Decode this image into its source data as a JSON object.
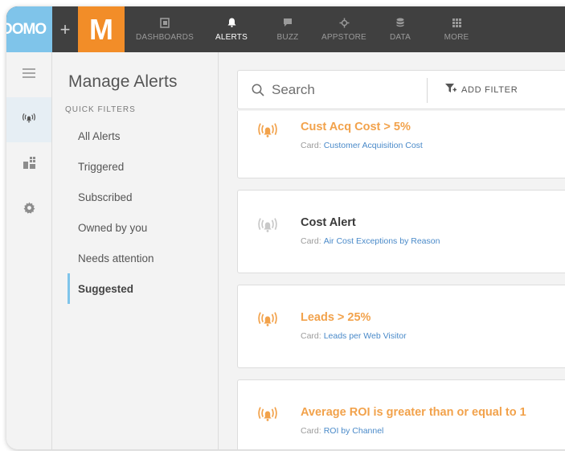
{
  "brand": {
    "logo_text": "DOMO",
    "plus": "+",
    "m_letter": "M"
  },
  "colors": {
    "topbar": "#404040",
    "logo_bg": "#7fc4ea",
    "m_bg": "#f28d28",
    "alert_orange": "#f2a24b",
    "link": "#4a8ac9"
  },
  "nav": [
    {
      "label": "DASHBOARDS",
      "icon": "dashboards-icon",
      "active": false
    },
    {
      "label": "ALERTS",
      "icon": "bell-icon",
      "active": true
    },
    {
      "label": "BUZZ",
      "icon": "chat-icon",
      "active": false
    },
    {
      "label": "APPSTORE",
      "icon": "appstore-icon",
      "active": false
    },
    {
      "label": "DATA",
      "icon": "database-icon",
      "active": false
    },
    {
      "label": "MORE",
      "icon": "grid-icon",
      "active": false
    }
  ],
  "rail": [
    {
      "icon": "menu-icon",
      "active": false
    },
    {
      "icon": "alert-signal-icon",
      "active": true
    },
    {
      "icon": "cards-icon",
      "active": false
    },
    {
      "icon": "gear-icon",
      "active": false
    }
  ],
  "sidebar": {
    "title": "Manage Alerts",
    "quick_filters_label": "QUICK FILTERS",
    "items": [
      {
        "label": "All Alerts",
        "active": false
      },
      {
        "label": "Triggered",
        "active": false
      },
      {
        "label": "Subscribed",
        "active": false
      },
      {
        "label": "Owned by you",
        "active": false
      },
      {
        "label": "Needs attention",
        "active": false
      },
      {
        "label": "Suggested",
        "active": true
      }
    ]
  },
  "search": {
    "placeholder": "Search",
    "add_filter_label": "ADD FILTER"
  },
  "alerts": [
    {
      "title": "Cust Acq Cost > 5%",
      "card_label": "Card:",
      "card_name": "Customer Acquisition Cost",
      "triggered": true
    },
    {
      "title": "Cost Alert",
      "card_label": "Card:",
      "card_name": "Air Cost Exceptions by Reason",
      "triggered": false
    },
    {
      "title": "Leads > 25%",
      "card_label": "Card:",
      "card_name": "Leads per Web Visitor",
      "triggered": true
    },
    {
      "title": "Average ROI is greater than or equal to 1",
      "card_label": "Card:",
      "card_name": "ROI by Channel",
      "triggered": true
    }
  ]
}
